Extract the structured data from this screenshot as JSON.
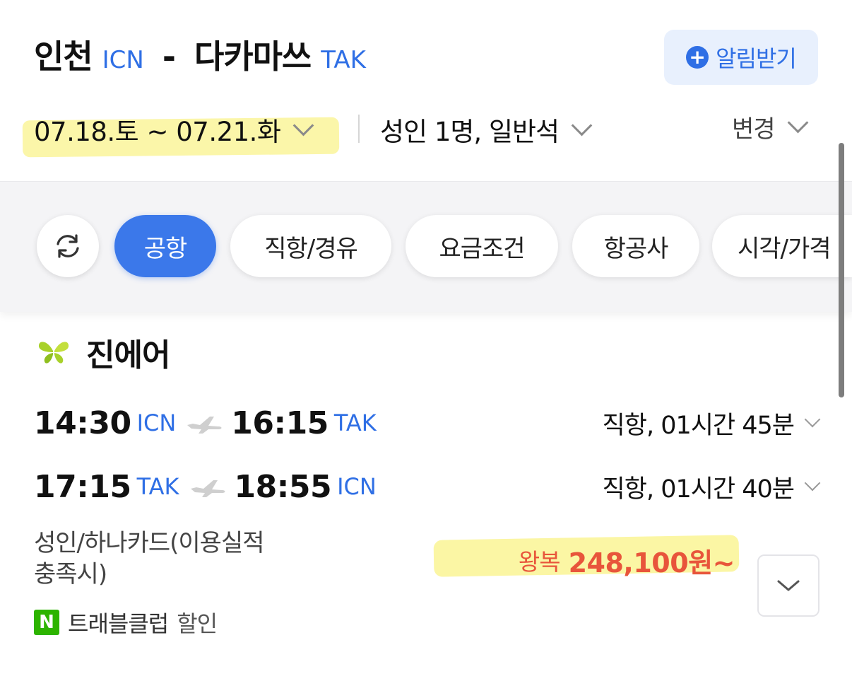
{
  "header": {
    "origin_city": "인천",
    "origin_code": "ICN",
    "separator": "-",
    "dest_city": "다카마쓰",
    "dest_code": "TAK",
    "alert_label": "알림받기",
    "dates": "07.18.토 ~ 07.21.화",
    "passengers": "성인 1명, 일반석",
    "change_label": "변경"
  },
  "filters": {
    "chips": [
      "공항",
      "직항/경유",
      "요금조건",
      "항공사",
      "시각/가격"
    ],
    "active": "공항"
  },
  "result": {
    "airline": "진에어",
    "legs": [
      {
        "dep_time": "14:30",
        "dep_code": "ICN",
        "arr_time": "16:15",
        "arr_code": "TAK",
        "info": "직항, 01시간 45분"
      },
      {
        "dep_time": "17:15",
        "dep_code": "TAK",
        "arr_time": "18:55",
        "arr_code": "ICN",
        "info": "직항, 01시간 40분"
      }
    ],
    "fare_condition_line1": "성인/하나카드(이용실적",
    "fare_condition_line2": "충족시)",
    "price_prefix": "왕복",
    "price": "248,100원~",
    "promo_badge": "N",
    "promo_name": "트래블클럽",
    "promo_label": "할인"
  },
  "colors": {
    "accent_blue": "#2f6fe5",
    "chip_active": "#3b78ea",
    "price_red": "#e8553b",
    "highlighter": "#fbf6a4",
    "naver_green": "#2db400"
  }
}
